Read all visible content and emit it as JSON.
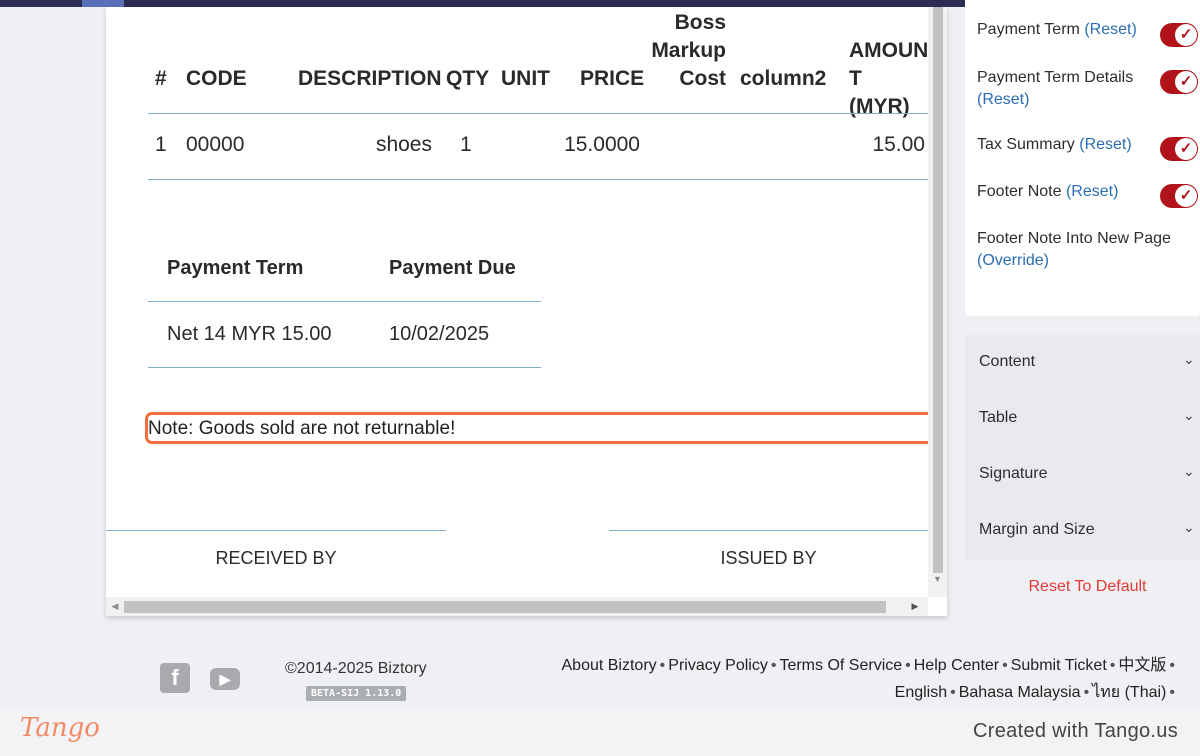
{
  "document": {
    "table": {
      "headers": {
        "num": "#",
        "code": "CODE",
        "description": "DESCRIPTION",
        "qty": "QTY",
        "unit": "UNIT",
        "price": "PRICE",
        "boss_line1": "Boss",
        "boss_line2": "Markup",
        "boss_line3": "Cost",
        "column2": "column2",
        "amount_line1": "AMOUN",
        "amount_line2": "T (MYR)"
      },
      "rows": [
        {
          "num": "1",
          "code": "00000",
          "description": "shoes",
          "qty": "1",
          "unit": "",
          "price": "15.0000",
          "boss": "",
          "column2": "",
          "amount": "15.00"
        }
      ]
    },
    "payment": {
      "term_header": "Payment Term",
      "due_header": "Payment Due",
      "term_value": "Net 14 MYR 15.00",
      "due_value": "10/02/2025"
    },
    "note": "Note: Goods sold are not returnable!",
    "received_by": "RECEIVED BY",
    "issued_by": "ISSUED BY"
  },
  "settings": {
    "items": [
      {
        "label": "Payment Term",
        "link": "(Reset)",
        "enabled": true
      },
      {
        "label": "Payment Term Details",
        "link": "(Reset)",
        "enabled": true
      },
      {
        "label": "Tax Summary",
        "link": "(Reset)",
        "enabled": true
      },
      {
        "label": "Footer Note",
        "link": "(Reset)",
        "enabled": true
      },
      {
        "label": "Footer Note Into New Page",
        "link": "(Override)",
        "enabled": false
      }
    ],
    "toggle_check": "✓"
  },
  "accordion": {
    "items": [
      "Content",
      "Table",
      "Signature",
      "Margin and Size"
    ],
    "chevron": "⌄"
  },
  "reset_default": "Reset To Default",
  "footer": {
    "copyright": "©2014-2025 Biztory",
    "version": "BETA-SIJ 1.13.0",
    "separator": "•",
    "links": [
      "About Biztory",
      "Privacy Policy",
      "Terms Of Service",
      "Help Center",
      "Submit Ticket",
      "中文版",
      "English",
      "Bahasa Malaysia",
      "ไทย (Thai)"
    ],
    "icons": [
      "facebook-icon",
      "youtube-icon"
    ],
    "facebook_glyph": "f",
    "youtube_glyph": "▶"
  },
  "tango": {
    "logo": "Tango",
    "credit": "Created with Tango.us"
  },
  "colors": {
    "toggle": "#b0131a",
    "link": "#2a6db5",
    "reset": "#e53935",
    "highlight": "#f26d3d",
    "topbar": "#2c2d54"
  }
}
